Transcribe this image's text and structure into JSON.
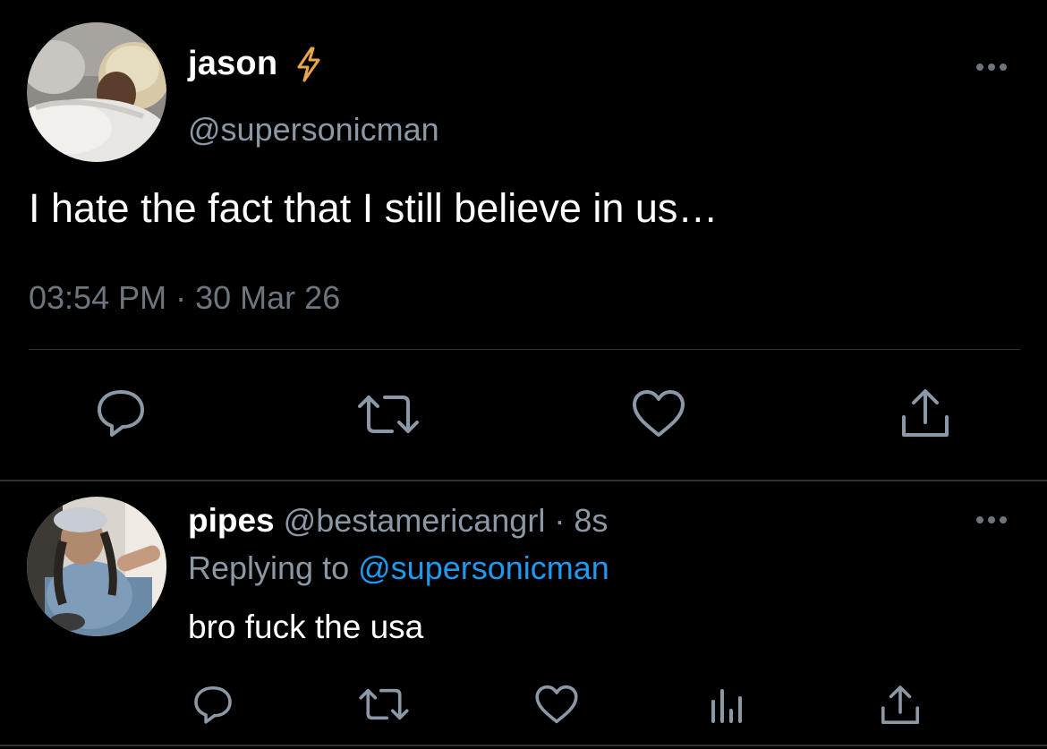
{
  "main_tweet": {
    "display_name": "jason",
    "verified_icon": "lightning-bolt-icon",
    "handle": "@supersonicman",
    "text": "I hate the fact that I still believe in us…",
    "time": "03:54 PM",
    "separator": "·",
    "date": "30 Mar 26",
    "actions": [
      "reply-icon",
      "retweet-icon",
      "like-icon",
      "share-icon"
    ]
  },
  "reply": {
    "display_name": "pipes",
    "handle": "@bestamericangrl",
    "separator": "·",
    "age": "8s",
    "replying_prefix": "Replying to",
    "replying_to": "@supersonicman",
    "text": "bro fuck the usa",
    "actions": [
      "reply-icon",
      "retweet-icon",
      "like-icon",
      "analytics-icon",
      "share-icon"
    ]
  },
  "colors": {
    "background": "#000000",
    "primary_text": "#ffffff",
    "secondary_text": "#8b98a5",
    "meta_text": "#6e767d",
    "link": "#1d9bf0",
    "bolt": "#e8a64a",
    "divider": "#2f3336"
  }
}
